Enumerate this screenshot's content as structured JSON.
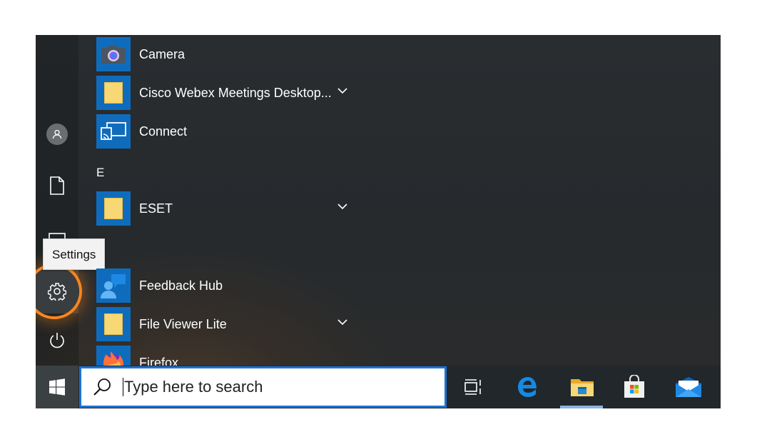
{
  "start_menu": {
    "apps": [
      {
        "label": "Camera",
        "icon": "camera-icon",
        "expandable": false
      },
      {
        "label": "Cisco Webex Meetings Desktop...",
        "icon": "folder-icon",
        "expandable": true
      },
      {
        "label": "Connect",
        "icon": "connect-icon",
        "expandable": false
      },
      {
        "label": "ESET",
        "icon": "folder-icon",
        "expandable": true
      },
      {
        "label": "Feedback Hub",
        "icon": "feedback-icon",
        "expandable": false
      },
      {
        "label": "File Viewer Lite",
        "icon": "folder-icon",
        "expandable": true
      },
      {
        "label": "Firefox",
        "icon": "firefox-icon",
        "expandable": false
      }
    ],
    "section_letters": [
      "E"
    ]
  },
  "rail": {
    "tooltip": "Settings",
    "items": [
      "user-icon",
      "document-icon",
      "pictures-icon",
      "gear-icon",
      "power-icon"
    ]
  },
  "taskbar": {
    "search_placeholder": "Type here to search",
    "icons": [
      "task-view-icon",
      "edge-icon",
      "file-explorer-icon",
      "store-icon",
      "mail-icon"
    ]
  },
  "colors": {
    "tile_blue": "#0f6cbd",
    "highlight_orange": "#f7861e",
    "search_border": "#1a73d9"
  }
}
